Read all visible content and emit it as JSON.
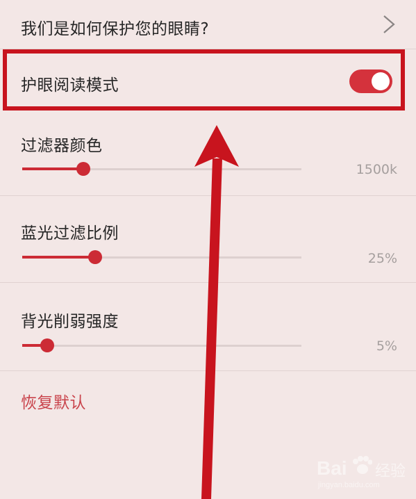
{
  "protect_eyes": {
    "label": "我们是如何保护您的眼睛?"
  },
  "eye_reading_mode": {
    "label": "护眼阅读模式",
    "enabled": true
  },
  "filter_color": {
    "label": "过滤器颜色",
    "value_text": "1500k",
    "fraction": 0.22
  },
  "blue_light_ratio": {
    "label": "蓝光过滤比例",
    "value_text": "25%",
    "fraction": 0.26
  },
  "backlight_weaken": {
    "label": "背光削弱强度",
    "value_text": "5%",
    "fraction": 0.09
  },
  "reset": {
    "label": "恢复默认"
  },
  "watermark": {
    "text": "Bai",
    "sub": "jingyan.baidu.com",
    "jingyan": "经验"
  },
  "colors": {
    "accent": "#cc2b35",
    "highlight": "#c8141e",
    "background": "#f3e7e6"
  }
}
